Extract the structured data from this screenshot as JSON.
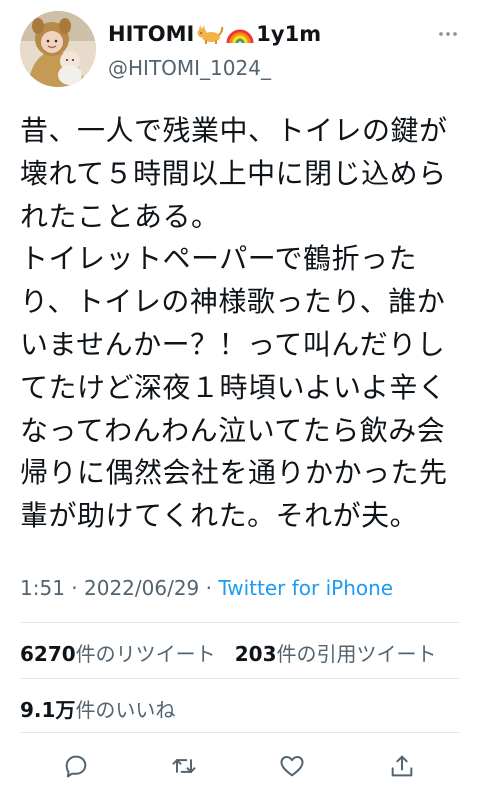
{
  "header": {
    "display_name": "HITOMI",
    "name_suffix": "1y1m",
    "handle": "@HITOMI_1024_",
    "icons": [
      "cat-icon",
      "rainbow-icon",
      "more-icon"
    ]
  },
  "tweet": {
    "text": "昔、一人で残業中、トイレの鍵が壊れて５時間以上中に閉じ込められたことある。\nトイレットペーパーで鶴折ったり、トイレの神様歌ったり、誰かいませんかー？！って叫んだりしてたけど深夜１時頃いよいよ辛くなってわんわん泣いてたら飲み会帰りに偶然会社を通りかかった先輩が助けてくれた。それが夫。"
  },
  "meta": {
    "time": "1:51",
    "sep1": " · ",
    "date": "2022/06/29",
    "sep2": " · ",
    "source": "Twitter for iPhone"
  },
  "stats": {
    "retweets_count": "6270",
    "retweets_label": "件のリツイート",
    "quotes_count": "203",
    "quotes_label": "件の引用ツイート",
    "likes_count": "9.1万",
    "likes_label": "件のいいね"
  },
  "actions": {
    "icons": [
      "reply-icon",
      "retweet-icon",
      "like-icon",
      "share-icon"
    ]
  },
  "colors": {
    "text": "#0f1419",
    "secondary": "#536471",
    "link": "#1d9bf0",
    "divider": "#e6e9eb",
    "background": "#ffffff"
  }
}
